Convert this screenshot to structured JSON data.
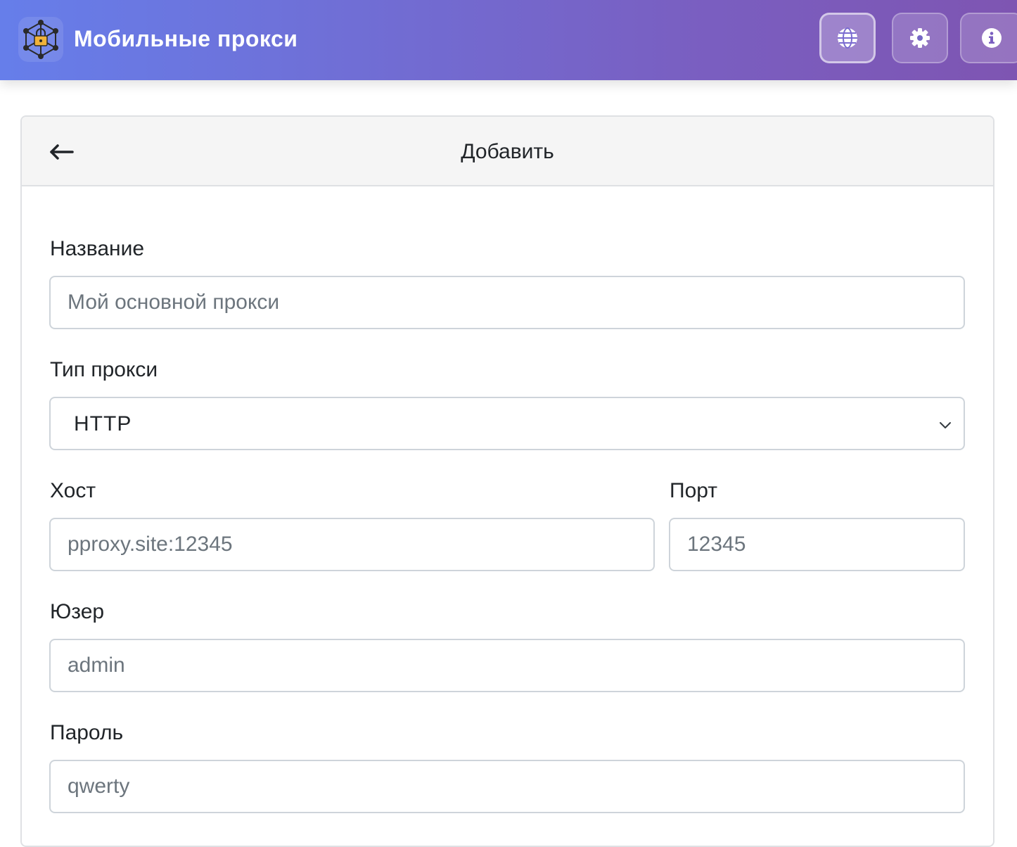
{
  "header": {
    "app_title": "Мобильные прокси",
    "buttons": [
      {
        "name": "globe-button",
        "icon": "globe-icon",
        "active": true
      },
      {
        "name": "settings-button",
        "icon": "gear-icon",
        "active": false
      },
      {
        "name": "info-button",
        "icon": "info-icon",
        "active": false
      }
    ],
    "gradient_colors": [
      "#667eea",
      "#7e55b2"
    ]
  },
  "card": {
    "title": "Добавить",
    "back_icon": "arrow-left-icon"
  },
  "form": {
    "name": {
      "label": "Название",
      "placeholder": "Мой основной прокси",
      "value": ""
    },
    "proxy_type": {
      "label": "Тип прокси",
      "selected": "HTTP"
    },
    "host": {
      "label": "Хост",
      "placeholder": "pproxy.site:12345",
      "value": ""
    },
    "port": {
      "label": "Порт",
      "placeholder": "12345",
      "value": ""
    },
    "user": {
      "label": "Юзер",
      "placeholder": "admin",
      "value": ""
    },
    "password": {
      "label": "Пароль",
      "placeholder": "qwerty",
      "value": ""
    }
  }
}
